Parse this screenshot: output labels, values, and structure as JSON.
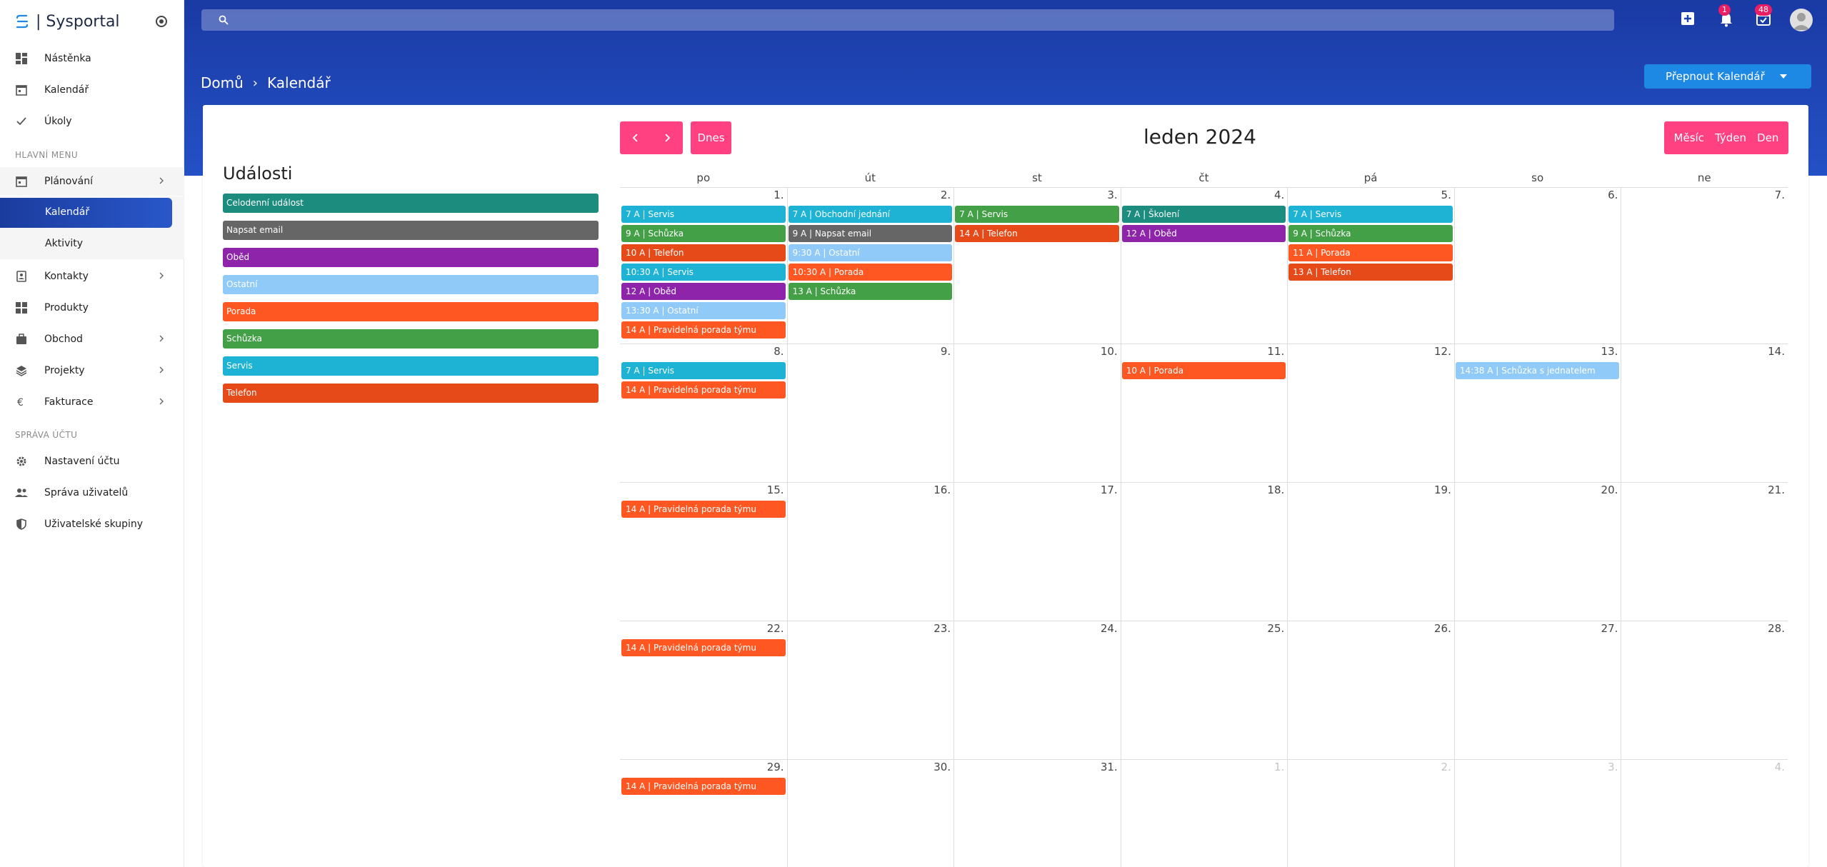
{
  "app": {
    "brand": "| Sysportal"
  },
  "nav": {
    "top_items": [
      "Nástěnka",
      "Kalendář",
      "Úkoly"
    ],
    "section_main": "HLAVNÍ MENU",
    "planovani": "Plánování",
    "sub_items": [
      "Kalendář",
      "Aktivity"
    ],
    "main_items": [
      "Kontakty",
      "Produkty",
      "Obchod",
      "Projekty",
      "Fakturace"
    ],
    "section_account": "SPRÁVA ÚČTU",
    "account_items": [
      "Nastavení účtu",
      "Správa uživatelů",
      "Uživatelské skupiny"
    ]
  },
  "header": {
    "notifications_count": "1",
    "calendar_count": "48",
    "breadcrumb": [
      "Domů",
      "Kalendář"
    ],
    "switch_button": "Přepnout Kalendář"
  },
  "events_panel": {
    "title": "Události",
    "items": [
      {
        "label": "Celodenní událost",
        "color": "#1b8c7e"
      },
      {
        "label": "Napsat email",
        "color": "#666666"
      },
      {
        "label": "Oběd",
        "color": "#8e24aa"
      },
      {
        "label": "Ostatní",
        "color": "#90caf9"
      },
      {
        "label": "Porada",
        "color": "#ff5722"
      },
      {
        "label": "Schůzka",
        "color": "#43a047"
      },
      {
        "label": "Servis",
        "color": "#1eb3d4"
      },
      {
        "label": "Telefon",
        "color": "#e64a19"
      }
    ]
  },
  "calendar": {
    "today_label": "Dnes",
    "title": "leden 2024",
    "views": [
      "Měsíc",
      "Týden",
      "Den"
    ],
    "weekdays": [
      "po",
      "út",
      "st",
      "čt",
      "pá",
      "so",
      "ne"
    ],
    "weeks": [
      [
        "1.",
        "2.",
        "3.",
        "4.",
        "5.",
        "6.",
        "7."
      ],
      [
        "8.",
        "9.",
        "10.",
        "11.",
        "12.",
        "13.",
        "14."
      ],
      [
        "15.",
        "16.",
        "17.",
        "18.",
        "19.",
        "20.",
        "21."
      ],
      [
        "22.",
        "23.",
        "24.",
        "25.",
        "26.",
        "27.",
        "28."
      ],
      [
        "29.",
        "30.",
        "31.",
        "1.",
        "2.",
        "3.",
        "4."
      ]
    ],
    "events": [
      {
        "week": 0,
        "day": 0,
        "slot": 0,
        "label": "7 A | Servis",
        "color": "#1eb3d4"
      },
      {
        "week": 0,
        "day": 0,
        "slot": 1,
        "label": "9 A | Schůzka",
        "color": "#43a047"
      },
      {
        "week": 0,
        "day": 0,
        "slot": 2,
        "label": "10 A | Telefon",
        "color": "#e64a19"
      },
      {
        "week": 0,
        "day": 0,
        "slot": 3,
        "label": "10:30 A | Servis",
        "color": "#1eb3d4"
      },
      {
        "week": 0,
        "day": 0,
        "slot": 4,
        "label": "12 A | Oběd",
        "color": "#8e24aa"
      },
      {
        "week": 0,
        "day": 0,
        "slot": 5,
        "label": "13:30 A | Ostatní",
        "color": "#90caf9"
      },
      {
        "week": 0,
        "day": 0,
        "slot": 6,
        "label": "14 A | Pravidelná porada týmu",
        "color": "#ff5722"
      },
      {
        "week": 0,
        "day": 1,
        "slot": 0,
        "label": "7 A | Obchodní jednání",
        "color": "#1eb3d4"
      },
      {
        "week": 0,
        "day": 1,
        "slot": 1,
        "label": "9 A | Napsat email",
        "color": "#666666"
      },
      {
        "week": 0,
        "day": 1,
        "slot": 2,
        "label": "9:30 A | Ostatní",
        "color": "#90caf9"
      },
      {
        "week": 0,
        "day": 1,
        "slot": 3,
        "label": "10:30 A | Porada",
        "color": "#ff5722"
      },
      {
        "week": 0,
        "day": 1,
        "slot": 4,
        "label": "13 A | Schůzka",
        "color": "#43a047"
      },
      {
        "week": 0,
        "day": 2,
        "slot": 0,
        "label": "7 A | Servis",
        "color": "#43a047"
      },
      {
        "week": 0,
        "day": 2,
        "slot": 1,
        "label": "14 A | Telefon",
        "color": "#e64a19"
      },
      {
        "week": 0,
        "day": 3,
        "slot": 0,
        "label": "7 A | Školení",
        "color": "#1b8c7e"
      },
      {
        "week": 0,
        "day": 3,
        "slot": 1,
        "label": "12 A | Oběd",
        "color": "#8e24aa"
      },
      {
        "week": 0,
        "day": 4,
        "slot": 0,
        "label": "7 A | Servis",
        "color": "#1eb3d4"
      },
      {
        "week": 0,
        "day": 4,
        "slot": 1,
        "label": "9 A | Schůzka",
        "color": "#43a047"
      },
      {
        "week": 0,
        "day": 4,
        "slot": 2,
        "label": "11 A | Porada",
        "color": "#ff5722"
      },
      {
        "week": 0,
        "day": 4,
        "slot": 3,
        "label": "13 A | Telefon",
        "color": "#e64a19"
      },
      {
        "week": 1,
        "day": 0,
        "slot": 0,
        "label": "7 A | Servis",
        "color": "#1eb3d4"
      },
      {
        "week": 1,
        "day": 0,
        "slot": 1,
        "label": "14 A | Pravidelná porada týmu",
        "color": "#ff5722"
      },
      {
        "week": 1,
        "day": 3,
        "slot": 0,
        "label": "10 A | Porada",
        "color": "#ff5722"
      },
      {
        "week": 1,
        "day": 5,
        "slot": 0,
        "label": "14:38 A | Schůzka s jednatelem",
        "color": "#90caf9"
      },
      {
        "week": 2,
        "day": 0,
        "slot": 0,
        "label": "14 A | Pravidelná porada týmu",
        "color": "#ff5722"
      },
      {
        "week": 3,
        "day": 0,
        "slot": 0,
        "label": "14 A | Pravidelná porada týmu",
        "color": "#ff5722"
      },
      {
        "week": 4,
        "day": 0,
        "slot": 0,
        "label": "14 A | Pravidelná porada týmu",
        "color": "#ff5722"
      }
    ]
  }
}
